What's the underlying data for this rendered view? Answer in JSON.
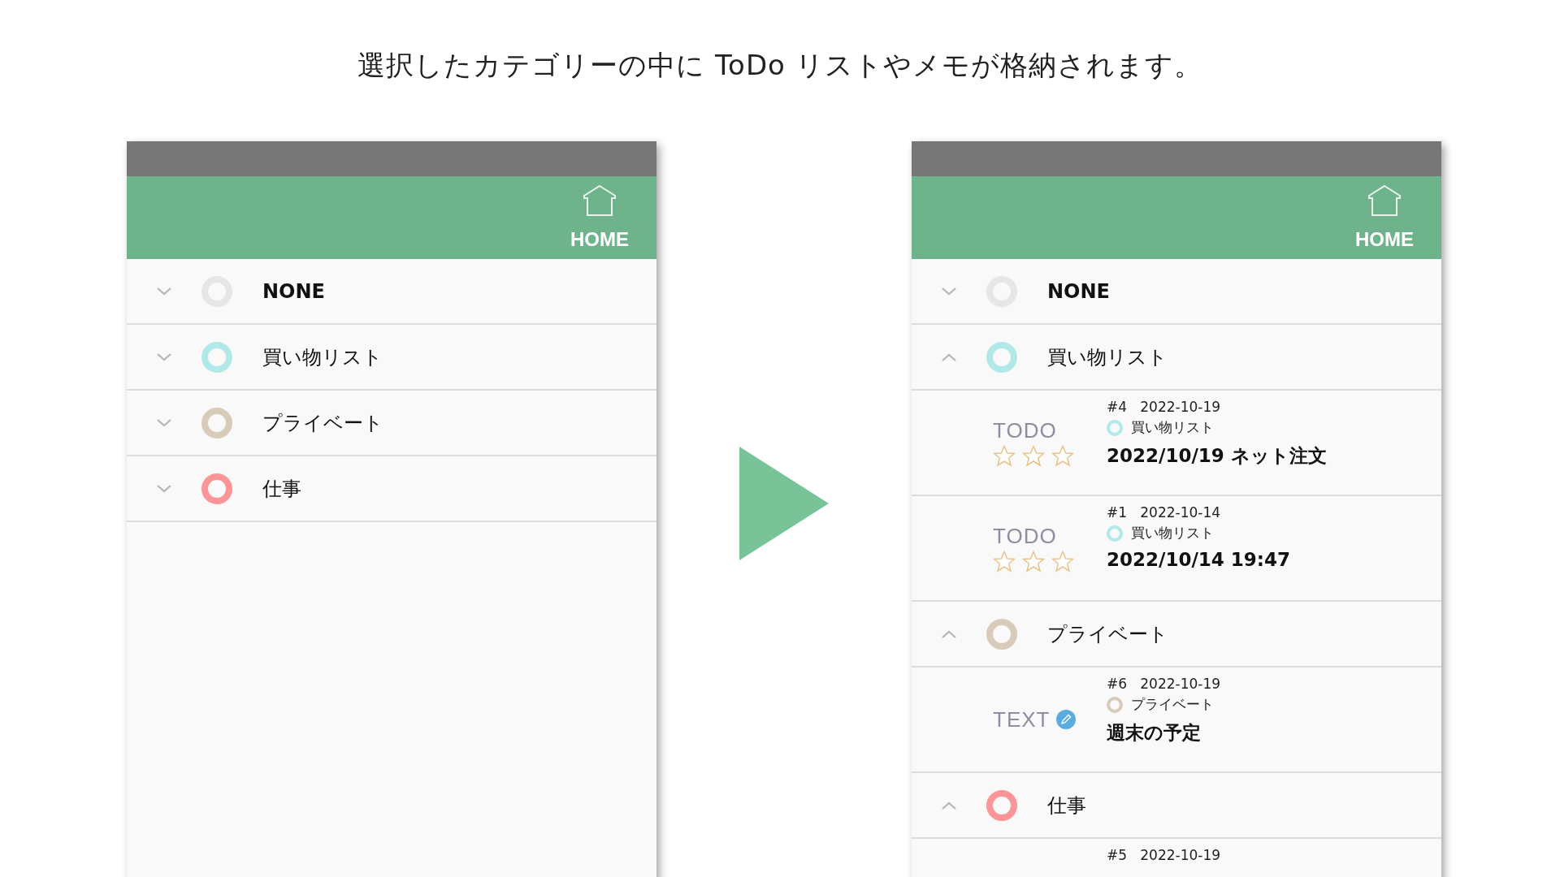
{
  "heading": "選択したカテゴリーの中に ToDo リストやメモが格納されます。",
  "screens": [
    {
      "header": {
        "home_label": "HOME"
      },
      "categories": [
        {
          "name": "NONE",
          "color": "#e6e6e6",
          "expanded": false,
          "bold": true
        },
        {
          "name": "買い物リスト",
          "color": "#b3e8e8",
          "expanded": false,
          "bold": false
        },
        {
          "name": "プライベート",
          "color": "#d8cbb9",
          "expanded": false,
          "bold": false
        },
        {
          "name": "仕事",
          "color": "#fb9597",
          "expanded": false,
          "bold": false
        }
      ]
    },
    {
      "header": {
        "home_label": "HOME"
      },
      "categories": [
        {
          "name": "NONE",
          "color": "#e6e6e6",
          "expanded": false,
          "bold": true
        },
        {
          "name": "買い物リスト",
          "color": "#b3e8e8",
          "expanded": true,
          "bold": false,
          "items": [
            {
              "kind": "todo",
              "type_label": "TODO",
              "stars": 0,
              "number": "#4",
              "date": "2022-10-19",
              "category": "買い物リスト",
              "title": "2022/10/19 ネット注文"
            },
            {
              "kind": "todo",
              "type_label": "TODO",
              "stars": 0,
              "number": "#1",
              "date": "2022-10-14",
              "category": "買い物リスト",
              "title": "2022/10/14 19:47"
            }
          ]
        },
        {
          "name": "プライベート",
          "color": "#d8cbb9",
          "expanded": true,
          "bold": false,
          "items": [
            {
              "kind": "text",
              "type_label": "TEXT",
              "number": "#6",
              "date": "2022-10-19",
              "category": "プライベート",
              "title": "週末の予定"
            }
          ]
        },
        {
          "name": "仕事",
          "color": "#fb9597",
          "expanded": true,
          "bold": false,
          "items": [
            {
              "kind": "partial",
              "number": "#5",
              "date": "2022-10-19"
            }
          ]
        }
      ]
    }
  ]
}
